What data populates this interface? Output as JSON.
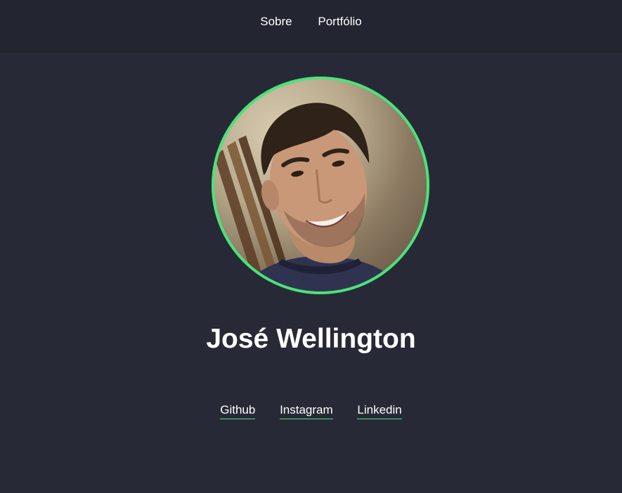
{
  "nav": {
    "items": [
      {
        "label": "Sobre"
      },
      {
        "label": "Portfólio"
      }
    ]
  },
  "profile": {
    "name": "José Wellington",
    "avatar_border_color": "#4be37a"
  },
  "social": {
    "links": [
      {
        "label": "Github"
      },
      {
        "label": "Instagram"
      },
      {
        "label": "Linkedin"
      }
    ]
  },
  "colors": {
    "background": "#272a36",
    "header": "#232630",
    "accent": "#4be37a",
    "text": "#ffffff"
  }
}
